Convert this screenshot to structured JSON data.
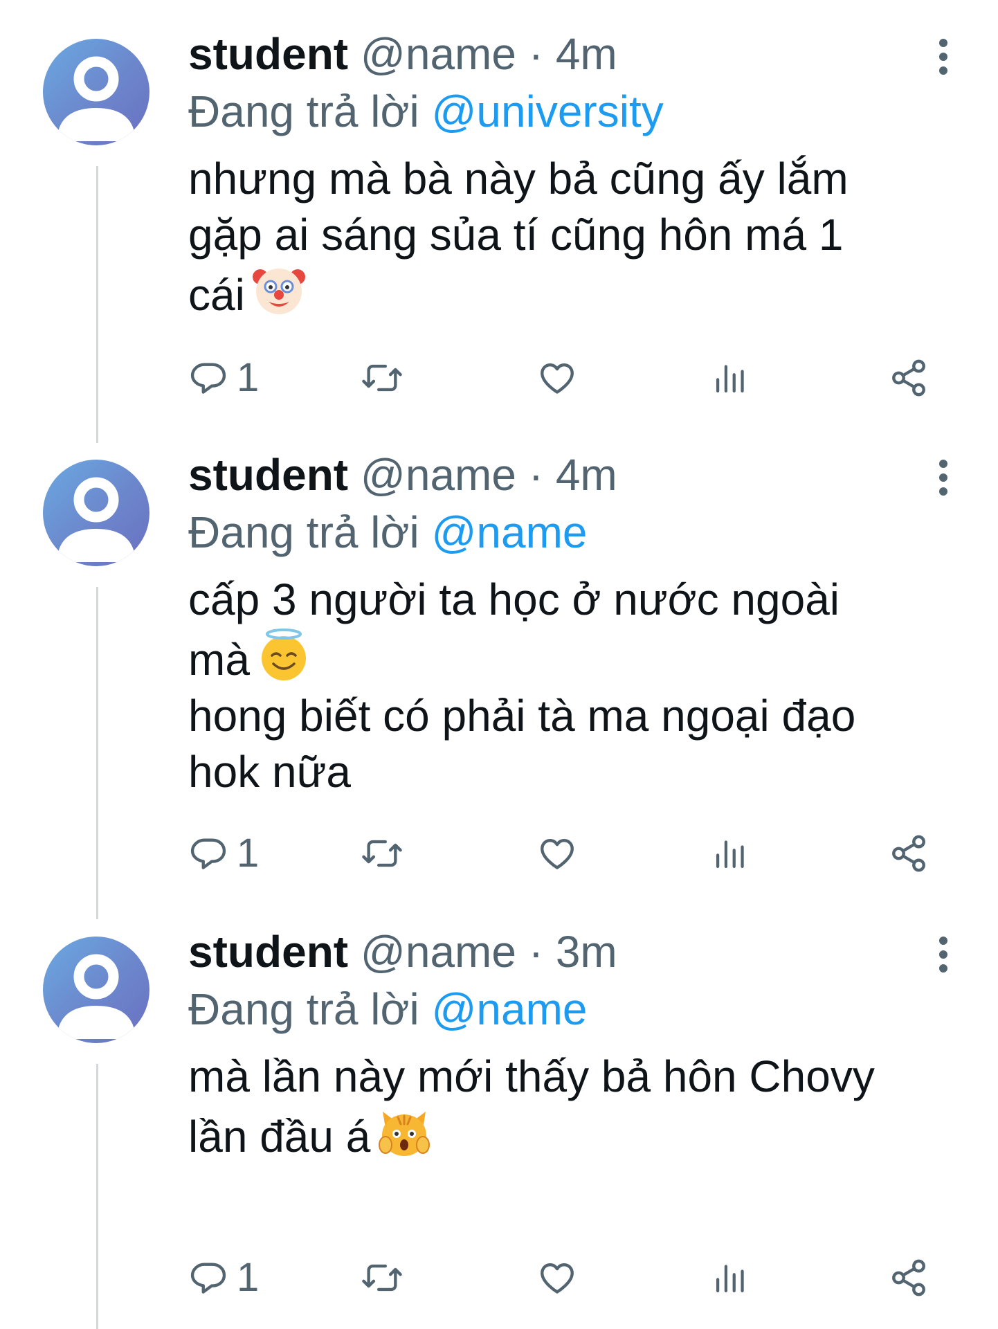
{
  "tweets": [
    {
      "name": "student",
      "handle": "@name",
      "separator": "·",
      "time": "4m",
      "replying_prefix": "Đang trả lời",
      "replying_to": "@university",
      "lines": [
        "nhưng mà bà này bả cũng ấy lắm",
        "gặp ai sáng sủa tí cũng hôn má 1",
        "cái"
      ],
      "emoji": "clown-face-emoji",
      "reply_count": "1"
    },
    {
      "name": "student",
      "handle": "@name",
      "separator": "·",
      "time": "4m",
      "replying_prefix": "Đang trả lời",
      "replying_to": "@name",
      "lines": [
        "cấp 3 người ta học ở nước ngoài",
        "mà",
        "hong biết có phải tà ma ngoại đạo",
        "hok nữa"
      ],
      "emoji": "smiling-face-with-halo-emoji",
      "reply_count": "1"
    },
    {
      "name": "student",
      "handle": "@name",
      "separator": "·",
      "time": "3m",
      "replying_prefix": "Đang trả lời",
      "replying_to": "@name",
      "lines": [
        "mà lần này mới thấy bả hôn Chovy",
        "lần đầu á"
      ],
      "emoji": "weary-cat-emoji",
      "reply_count": "1"
    }
  ],
  "colors": {
    "text": "#0f1419",
    "secondary": "#536471",
    "mention": "#1d9bf0",
    "thread_line": "#cfd9de"
  },
  "icons": [
    "reply-icon",
    "retweet-icon",
    "like-icon",
    "views-icon",
    "share-icon",
    "more-icon"
  ]
}
